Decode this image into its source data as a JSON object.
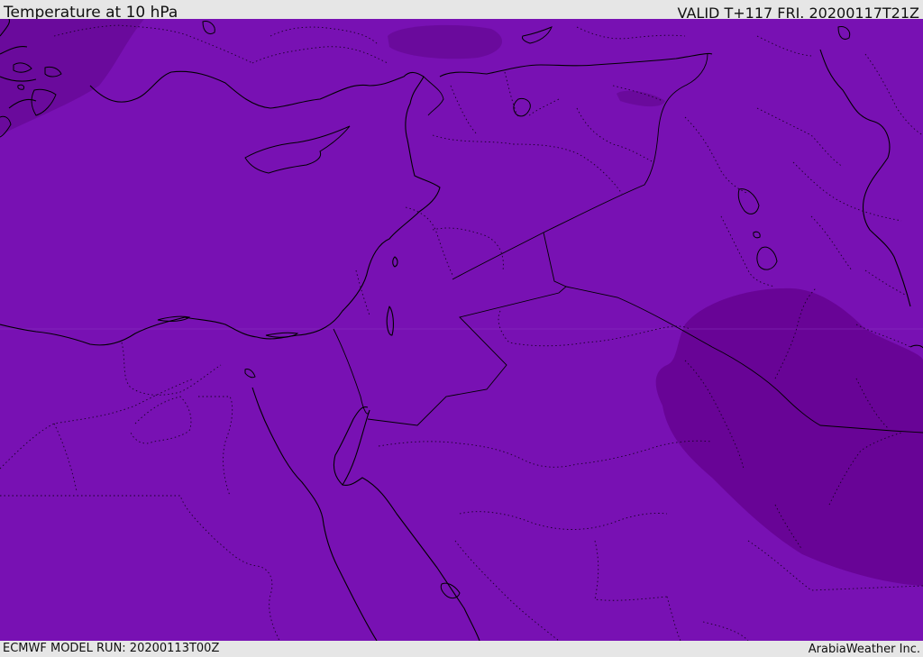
{
  "header": {
    "title": "Temperature at 10 hPa",
    "valid": "VALID T+117 FRI. 20200117T21Z"
  },
  "footer": {
    "model_run": "ECMWF MODEL RUN: 20200113T00Z",
    "credit": "ArabiaWeather Inc."
  },
  "map": {
    "region": "Eastern Mediterranean and Middle East",
    "colors": {
      "base_fill": "#7811b3",
      "cold_fill": "#680496",
      "coastline": "#000000",
      "border": "#000000",
      "admin_border": "#1a0028"
    }
  }
}
